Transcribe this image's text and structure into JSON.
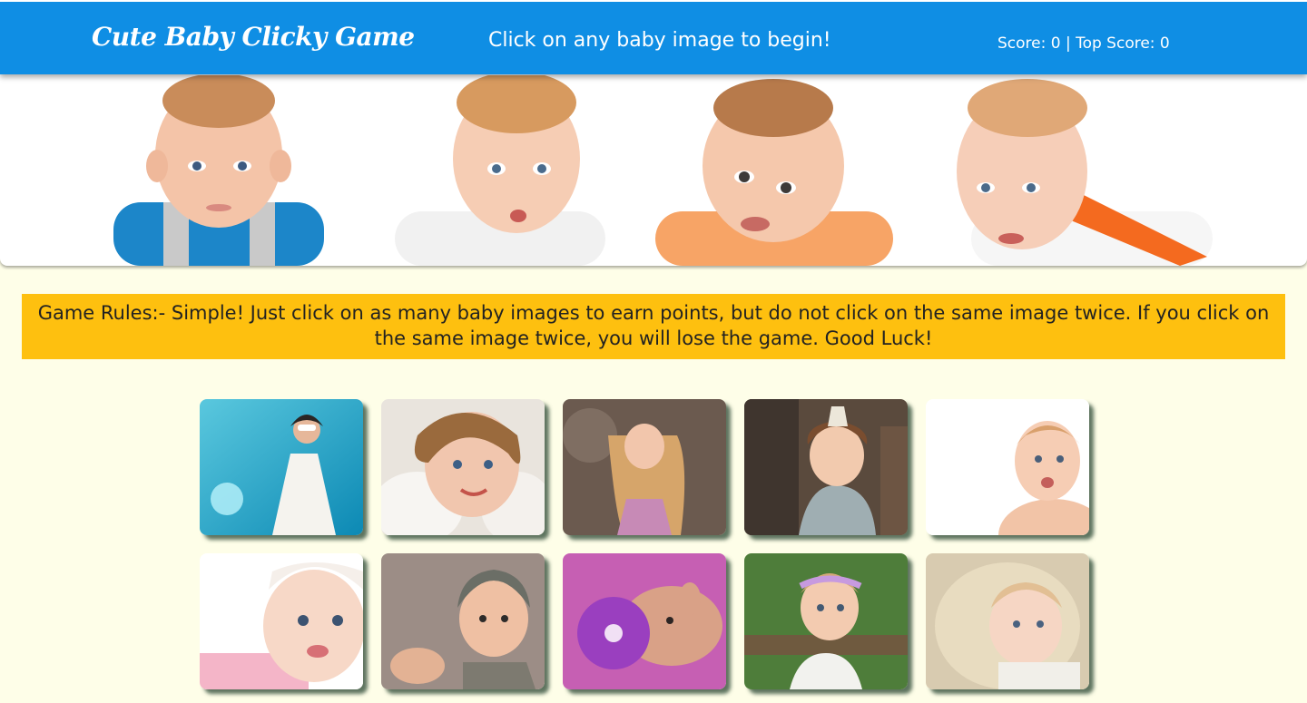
{
  "navbar": {
    "brand": "Cute Baby Clicky Game",
    "message": "Click on any baby image to begin!",
    "score_text": "Score: 0 | Top Score: 0"
  },
  "rules": {
    "text": "Game Rules:- Simple! Just click on as many baby images to earn points, but do not click on the same image twice. If you click on the same image twice, you will lose the game. Good Luck!"
  },
  "colors": {
    "navbar": "#0f8ee4",
    "rules_background": "#fec00f",
    "page_background": "#fefee8"
  },
  "banner": {
    "babies": [
      {
        "name": "baby-blue-overalls"
      },
      {
        "name": "baby-white-shirt"
      },
      {
        "name": "baby-orange-shirt"
      },
      {
        "name": "baby-orange-stripes"
      }
    ]
  },
  "cards": [
    {
      "name": "girl-underwater-sunglasses"
    },
    {
      "name": "smiling-toddler-feathers"
    },
    {
      "name": "long-hair-girl-pink-dress"
    },
    {
      "name": "toddler-girl-hair-bow"
    },
    {
      "name": "baby-kiss-face"
    },
    {
      "name": "baby-white-headband"
    },
    {
      "name": "baby-knit-hat"
    },
    {
      "name": "baby-purple-flower"
    },
    {
      "name": "toddler-flower-crown"
    },
    {
      "name": "baby-fur-blanket"
    }
  ]
}
